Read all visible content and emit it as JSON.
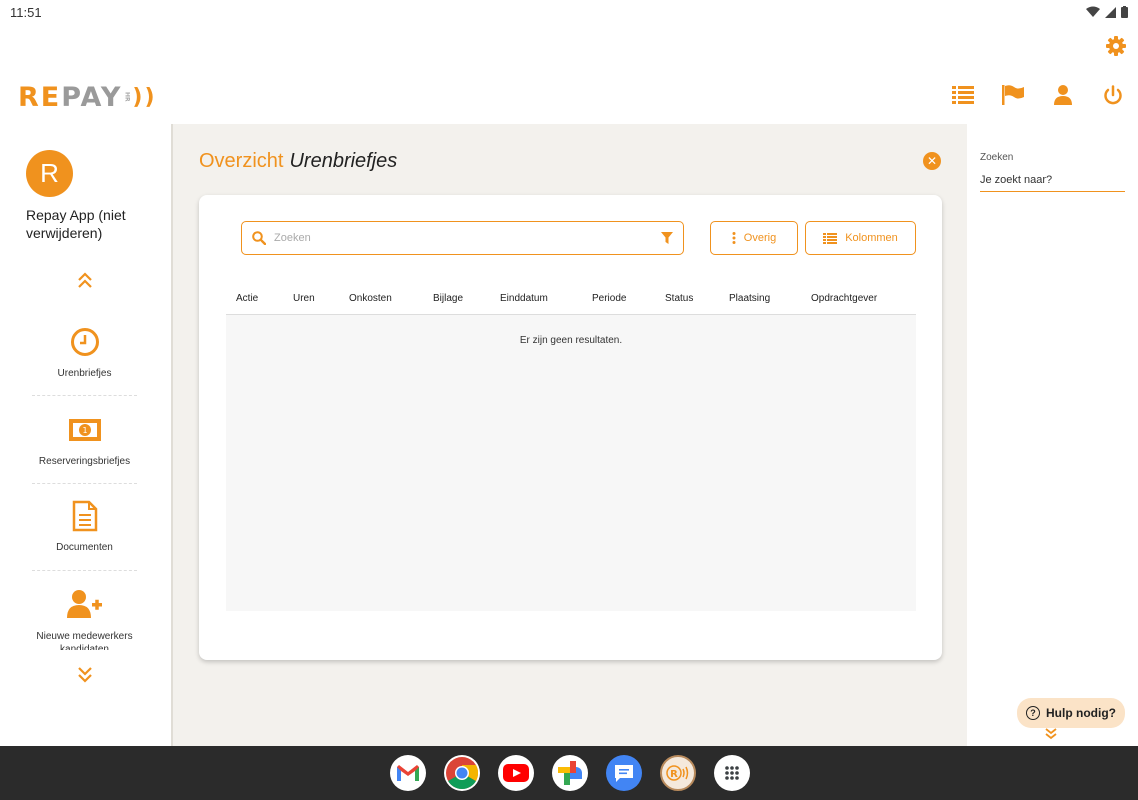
{
  "status": {
    "time": "11:51"
  },
  "header": {
    "logo_re": "RE",
    "logo_pay": "PAY",
    "logo_sub": "HR",
    "icons": [
      "list-icon",
      "flag-icon",
      "user-icon",
      "power-icon"
    ]
  },
  "sidebar": {
    "avatar_letter": "R",
    "user_name": "Repay App (niet verwijderen)",
    "items": [
      {
        "label": "Urenbriefjes",
        "icon": "clock-icon"
      },
      {
        "label": "Reserveringsbriefjes",
        "icon": "banknote-icon"
      },
      {
        "label": "Documenten",
        "icon": "document-icon"
      },
      {
        "label": "Nieuwe medewerkers kandidaten",
        "icon": "add-user-icon"
      }
    ]
  },
  "main": {
    "title_prefix": "Overzicht",
    "title": "Urenbriefjes",
    "search_placeholder": "Zoeken",
    "overig_label": "Overig",
    "kolommen_label": "Kolommen",
    "columns": [
      "Actie",
      "Uren",
      "Onkosten",
      "Bijlage",
      "Einddatum",
      "Periode",
      "Status",
      "Plaatsing",
      "Opdrachtgever"
    ],
    "empty_text": "Er zijn geen resultaten."
  },
  "rightpanel": {
    "search_label": "Zoeken",
    "search_value": "Je zoekt naar?",
    "help_label": "Hulp nodig?"
  },
  "taskbar": {
    "apps": [
      "Gmail",
      "Chrome",
      "YouTube",
      "Photos",
      "Messages",
      "Repay",
      "Apps"
    ]
  },
  "colors": {
    "accent": "#F0921E",
    "background": "#f3f1ed",
    "taskbar": "#2b2b2b"
  }
}
